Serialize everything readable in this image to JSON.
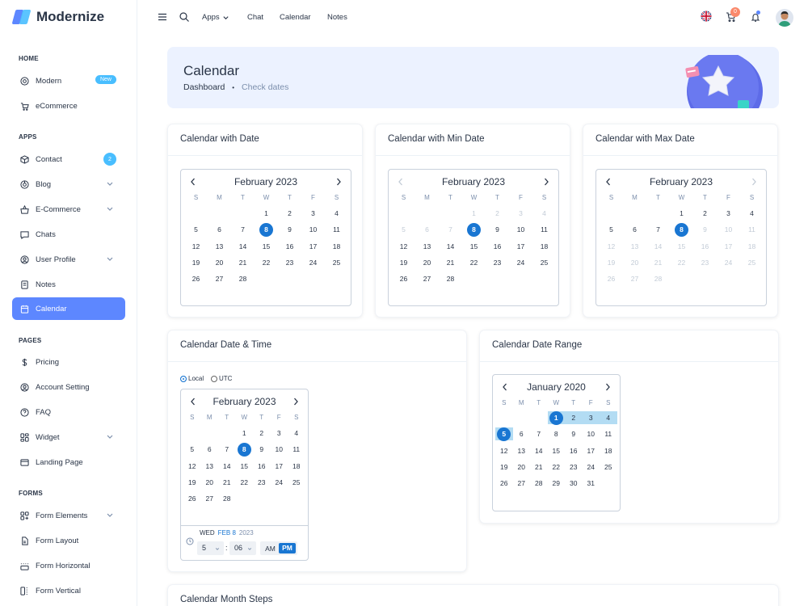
{
  "brand": {
    "name": "Modernize",
    "colors": {
      "primary": "#5d87ff",
      "info": "#49beff",
      "selected": "#1976d2",
      "range": "#b3dcf3"
    }
  },
  "sidebar": {
    "sections": {
      "home": "HOME",
      "apps": "APPS",
      "pages": "PAGES",
      "forms": "FORMS"
    },
    "items": {
      "modern": {
        "label": "Modern",
        "badge": "New",
        "icon": "aperture-icon"
      },
      "ecommerce": {
        "label": "eCommerce",
        "icon": "cart-icon"
      },
      "contact": {
        "label": "Contact",
        "badge": "2",
        "icon": "box-icon"
      },
      "blog": {
        "label": "Blog",
        "icon": "chart-donut-icon"
      },
      "eshop": {
        "label": "E-Commerce",
        "icon": "basket-icon"
      },
      "chats": {
        "label": "Chats",
        "icon": "message-icon"
      },
      "profile": {
        "label": "User Profile",
        "icon": "user-circle-icon"
      },
      "notes": {
        "label": "Notes",
        "icon": "notes-icon"
      },
      "calendar": {
        "label": "Calendar",
        "icon": "calendar-icon"
      },
      "pricing": {
        "label": "Pricing",
        "icon": "currency-dollar-icon"
      },
      "account": {
        "label": "Account Setting",
        "icon": "user-circle-icon"
      },
      "faq": {
        "label": "FAQ",
        "icon": "help-icon"
      },
      "widget": {
        "label": "Widget",
        "icon": "layout-icon"
      },
      "landing": {
        "label": "Landing Page",
        "icon": "app-window-icon"
      },
      "formelements": {
        "label": "Form Elements",
        "icon": "apps-icon"
      },
      "formlayout": {
        "label": "Form Layout",
        "icon": "file-description-icon"
      },
      "formhorizontal": {
        "label": "Form Horizontal",
        "icon": "box-align-bottom-icon"
      },
      "formvertical": {
        "label": "Form Vertical",
        "icon": "box-align-left-icon"
      }
    }
  },
  "topbar": {
    "apps": "Apps",
    "chat": "Chat",
    "calendar": "Calendar",
    "notes": "Notes",
    "cart_count": "0"
  },
  "hero": {
    "title": "Calendar",
    "crumb_home": "Dashboard",
    "crumb_sep": "•",
    "crumb_current": "Check dates"
  },
  "cards": {
    "date": "Calendar with Date",
    "min": "Calendar with Min Date",
    "max": "Calendar with Max Date",
    "datetime": "Calendar Date & Time",
    "range": "Calendar Date Range",
    "steps": "Calendar Month Steps"
  },
  "calendar": {
    "weekdays": [
      "S",
      "M",
      "T",
      "W",
      "T",
      "F",
      "S"
    ],
    "feb_title": "February 2023",
    "jan_title": "January 2020",
    "selected_day": "8",
    "range_start": "5",
    "range_end": "4"
  },
  "datetime": {
    "local": "Local",
    "utc": "UTC",
    "weekday": "WED",
    "date": "FEB 8",
    "year": "2023",
    "hour": "5",
    "colon": ":",
    "minute": "06",
    "am": "AM",
    "pm": "PM"
  }
}
